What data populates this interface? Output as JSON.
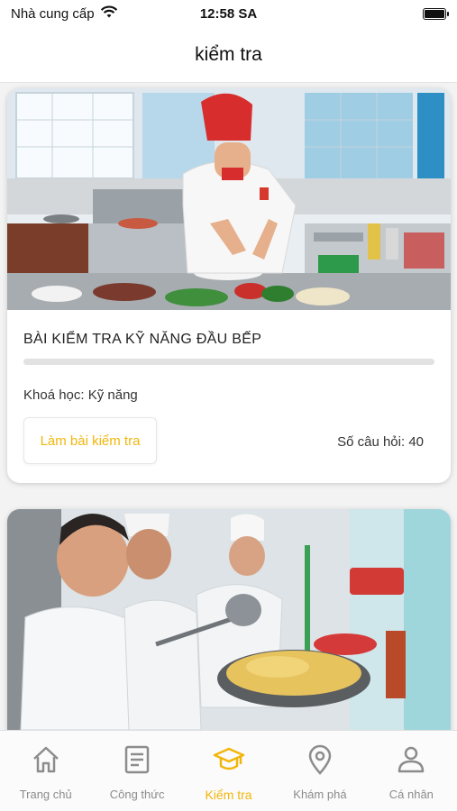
{
  "status_bar": {
    "carrier": "Nhà cung cấp",
    "time": "12:58 SA"
  },
  "header": {
    "title": "kiểm tra"
  },
  "tests": [
    {
      "title": "BÀI KIỂM TRA KỸ NĂNG ĐẦU BẾP",
      "progress": 0,
      "course": "Khoá học: Kỹ năng",
      "start_label": "Làm bài kiểm tra",
      "question_count": "Số câu hỏi: 40"
    }
  ],
  "tab_bar": {
    "items": [
      {
        "label": "Trang chủ",
        "icon": "home-icon",
        "active": false
      },
      {
        "label": "Công thức",
        "icon": "document-icon",
        "active": false
      },
      {
        "label": "Kiểm tra",
        "icon": "graduation-cap-icon",
        "active": true
      },
      {
        "label": "Khám phá",
        "icon": "location-pin-icon",
        "active": false
      },
      {
        "label": "Cá nhân",
        "icon": "person-icon",
        "active": false
      }
    ]
  },
  "colors": {
    "accent": "#f1b60b",
    "inactive": "#8c8c8c"
  }
}
